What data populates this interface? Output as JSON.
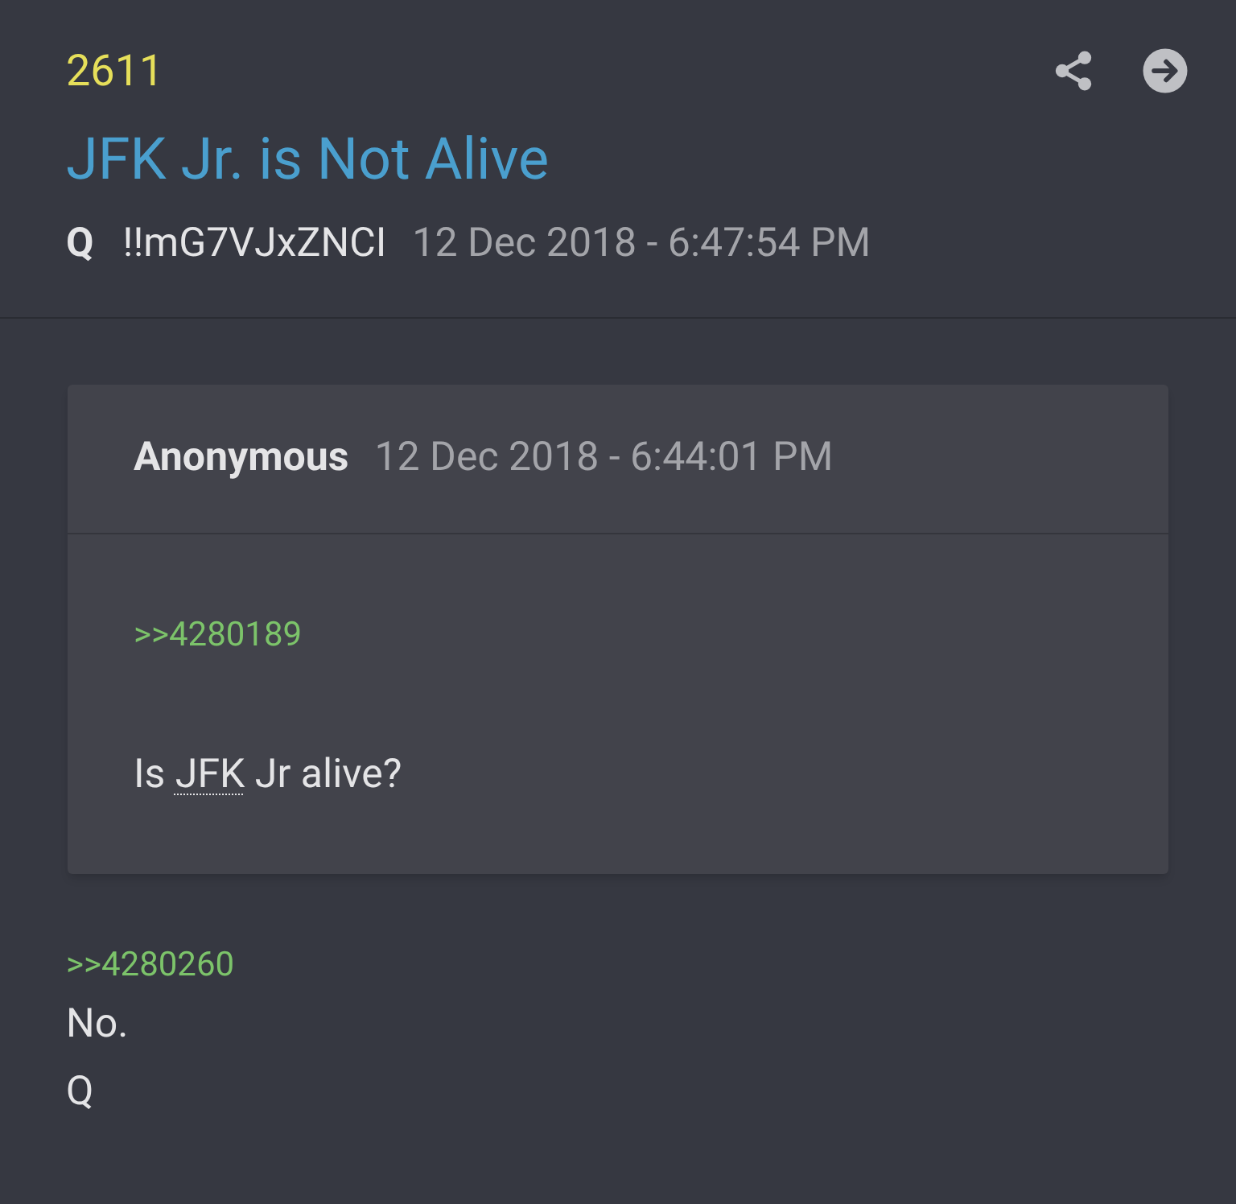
{
  "post": {
    "number": "2611",
    "title": "JFK Jr. is Not Alive",
    "author": "Q",
    "tripcode": "!!mG7VJxZNCI",
    "timestamp": "12 Dec 2018 - 6:47:54 PM"
  },
  "quote": {
    "author": "Anonymous",
    "timestamp": "12 Dec 2018 - 6:44:01 PM",
    "reply_link": ">>4280189",
    "body": [
      {
        "kind": "text",
        "text": "Is "
      },
      {
        "kind": "abbr",
        "text": "JFK"
      },
      {
        "kind": "text",
        "text": " Jr alive?"
      }
    ]
  },
  "reply_link": ">>4280260",
  "lines": [
    "No.",
    "Q"
  ]
}
